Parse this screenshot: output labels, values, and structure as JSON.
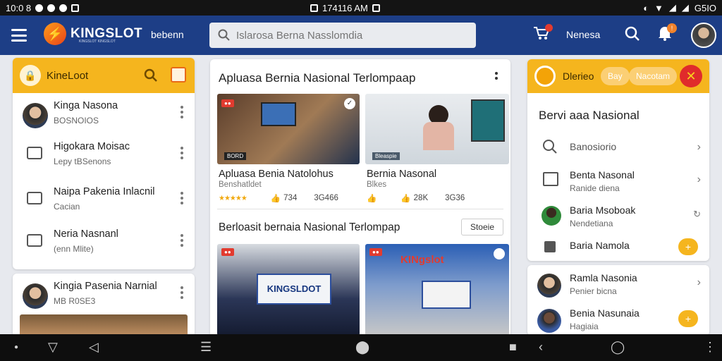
{
  "status": {
    "time": "10:0 8",
    "center_time": "174116 AM",
    "battery": "G5IO"
  },
  "topbar": {
    "brand": "KINGSLOT",
    "brand_sub": "KINGSLOT KINGSLOT",
    "nav_text": "bebenn",
    "search_placeholder": "Islarosa Berna Nasslomdia",
    "nav_label": "Nenesa",
    "bell_badge": "!"
  },
  "left_panel": {
    "header_title": "KineLoot",
    "items": [
      {
        "title": "Kinga Nasona",
        "sub": "BOSNOIOS"
      },
      {
        "title": "Higokara Moisac",
        "sub": "Lepy tBSenons"
      },
      {
        "title": "Naipa Pakenia Inlacnil",
        "sub": "Cacian"
      },
      {
        "title": "Neria Nasnanl",
        "sub": "(enn Mlite)"
      }
    ],
    "card2": {
      "title": "Kingia Pasenia Narnial",
      "sub": "MB R0SE3"
    }
  },
  "middle": {
    "title": "Apluasa Bernia Nasional Terlompaap",
    "cards": [
      {
        "title": "Apluasa Benia Natolohus",
        "sub": "Benshatldet",
        "badge": "BORD",
        "a": "734",
        "b": "3G466"
      },
      {
        "title": "Bernia Nasonal",
        "sub": "Blkes",
        "badge": "Bleaspie",
        "a": "28K",
        "b": "3G36"
      }
    ],
    "section2": "Berloasit bernaia Nasional Terlompap",
    "more_button": "Stoeie",
    "banner_text": "KINGSLDOT",
    "banner2_text": "KINgslot"
  },
  "right_panel": {
    "pill1": "Bay",
    "pill2": "Nacotam",
    "header_title": "Dlerieo",
    "section_title": "Bervi aaa Nasional",
    "items": [
      {
        "title": "Banosiorio",
        "sub": ""
      },
      {
        "title": "Benta Nasonal",
        "sub": "Ranide diena"
      },
      {
        "title": "Baria Msoboak",
        "sub": "Nendetiana"
      },
      {
        "title": "Baria Namola",
        "sub": ""
      }
    ],
    "card2": [
      {
        "title": "Ramla Nasonia",
        "sub": "Penier bicna"
      },
      {
        "title": "Benia Nasunaia",
        "sub": "Hagiaia"
      }
    ]
  }
}
